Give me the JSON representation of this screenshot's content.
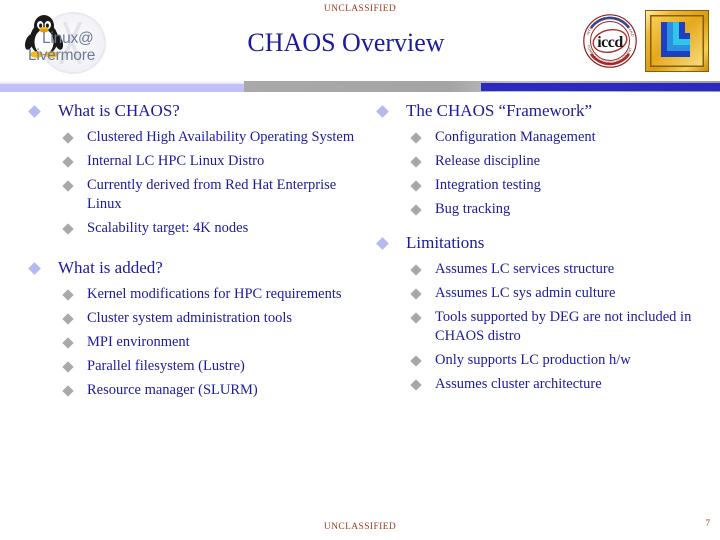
{
  "slide": {
    "title": "CHAOS Overview",
    "classification_top": "UNCLASSIFIED",
    "classification_bottom": "UNCLASSIFIED",
    "page_number": "7",
    "colors": {
      "title_blue": "#1b1b9e",
      "body_blue": "#1b1b9e",
      "classification_red": "#a03b21",
      "bullet_level1": "#b8b8f0",
      "bullet_level2": "#a8a8a8",
      "band_blue": "#2a2ac0",
      "band_lavender": "#bfbff5",
      "band_gray": "#a4a4a4",
      "logo_text_slate": "#6c7b96",
      "llnl_gold": "#e0a818",
      "llnl_blue": "#1d4fd8",
      "llnl_cyan": "#2fb6e8",
      "iccd_red": "#b12a2a"
    }
  },
  "logos": {
    "linux_livermore": {
      "line1": "Linux@",
      "line2": "Livermore"
    },
    "iccd": {
      "center_text": "iccd",
      "ring_top": "INTEGRATED COMPUTING AND",
      "ring_bottom": "COMMUNICATIONS DEPARTMENT"
    },
    "llnl": {
      "label": "LLNL"
    }
  },
  "content": {
    "left_column": [
      {
        "heading": "What is CHAOS?",
        "items": [
          "Clustered High Availability Operating System",
          "Internal LC HPC Linux Distro",
          "Currently derived from Red Hat Enterprise Linux",
          "Scalability target: 4K nodes"
        ]
      },
      {
        "heading": "What is added?",
        "items": [
          "Kernel modifications for HPC requirements",
          "Cluster system administration tools",
          "MPI environment",
          "Parallel filesystem (Lustre)",
          "Resource manager (SLURM)"
        ]
      }
    ],
    "right_column": [
      {
        "heading": "The CHAOS “Framework”",
        "items": [
          "Configuration Management",
          "Release discipline",
          "Integration testing",
          "Bug tracking"
        ]
      },
      {
        "heading": "Limitations",
        "items": [
          "Assumes LC services structure",
          "Assumes LC sys admin culture",
          "Tools supported by DEG are not included in CHAOS distro",
          "Only supports LC production h/w",
          "Assumes cluster architecture"
        ]
      }
    ]
  }
}
